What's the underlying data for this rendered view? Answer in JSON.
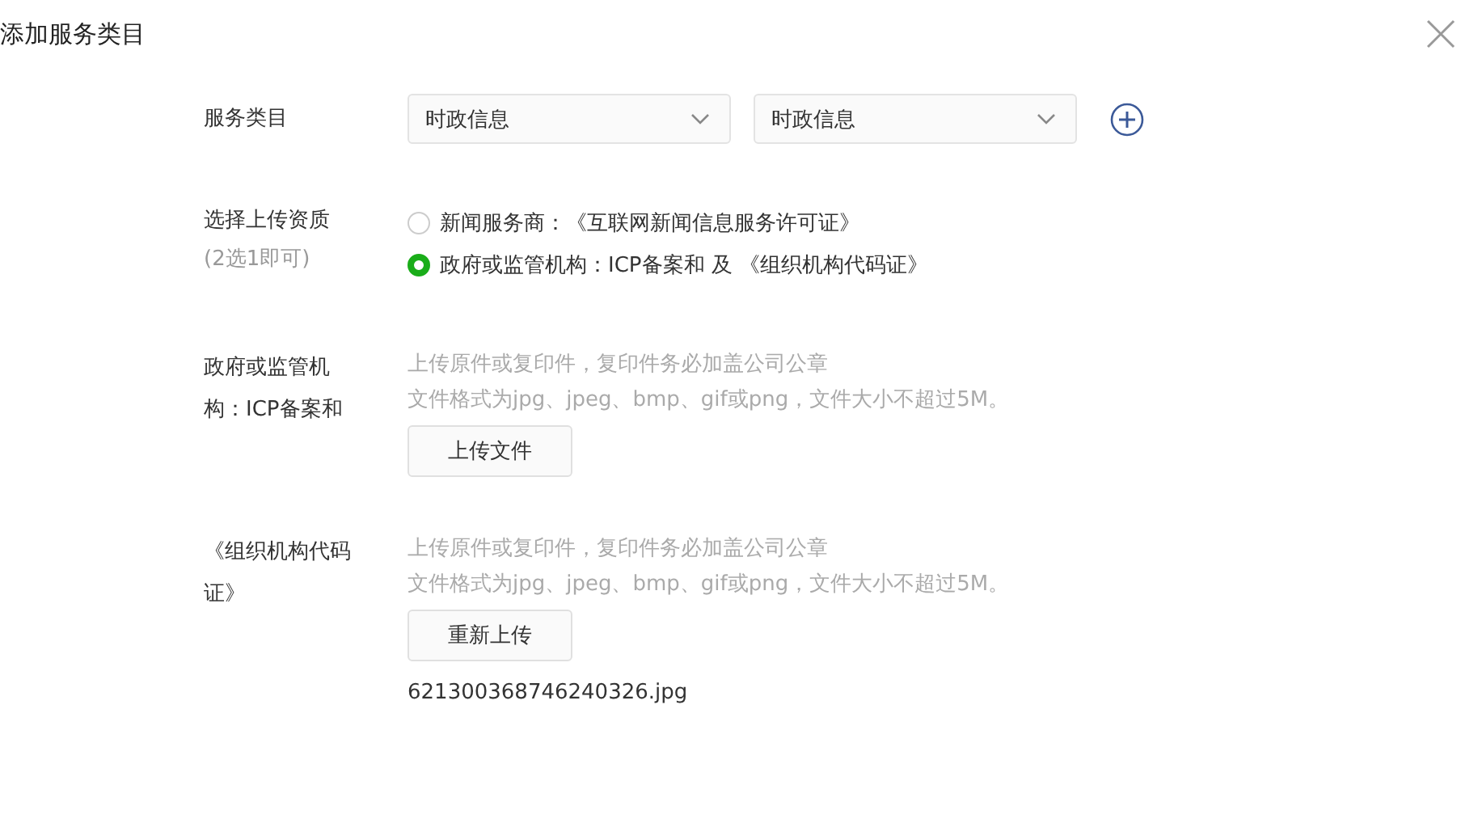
{
  "dialog": {
    "title": "添加服务类目"
  },
  "category": {
    "label": "服务类目",
    "selects": [
      {
        "value": "时政信息"
      },
      {
        "value": "时政信息"
      }
    ]
  },
  "qualification": {
    "label": "选择上传资质",
    "hint": "(2选1即可)",
    "options": [
      {
        "label": "新闻服务商：《互联网新闻信息服务许可证》",
        "selected": false
      },
      {
        "label": "政府或监管机构：ICP备案和 及 《组织机构代码证》",
        "selected": true
      }
    ]
  },
  "uploads": [
    {
      "label": "政府或监管机构：ICP备案和",
      "hints": [
        "上传原件或复印件，复印件务必加盖公司公章",
        "文件格式为jpg、jpeg、bmp、gif或png，文件大小不超过5M。"
      ],
      "button": "上传文件"
    },
    {
      "label": "《组织机构代码证》",
      "hints": [
        "上传原件或复印件，复印件务必加盖公司公章",
        "文件格式为jpg、jpeg、bmp、gif或png，文件大小不超过5M。"
      ],
      "button": "重新上传",
      "file": "621300368746240326.jpg"
    }
  ]
}
